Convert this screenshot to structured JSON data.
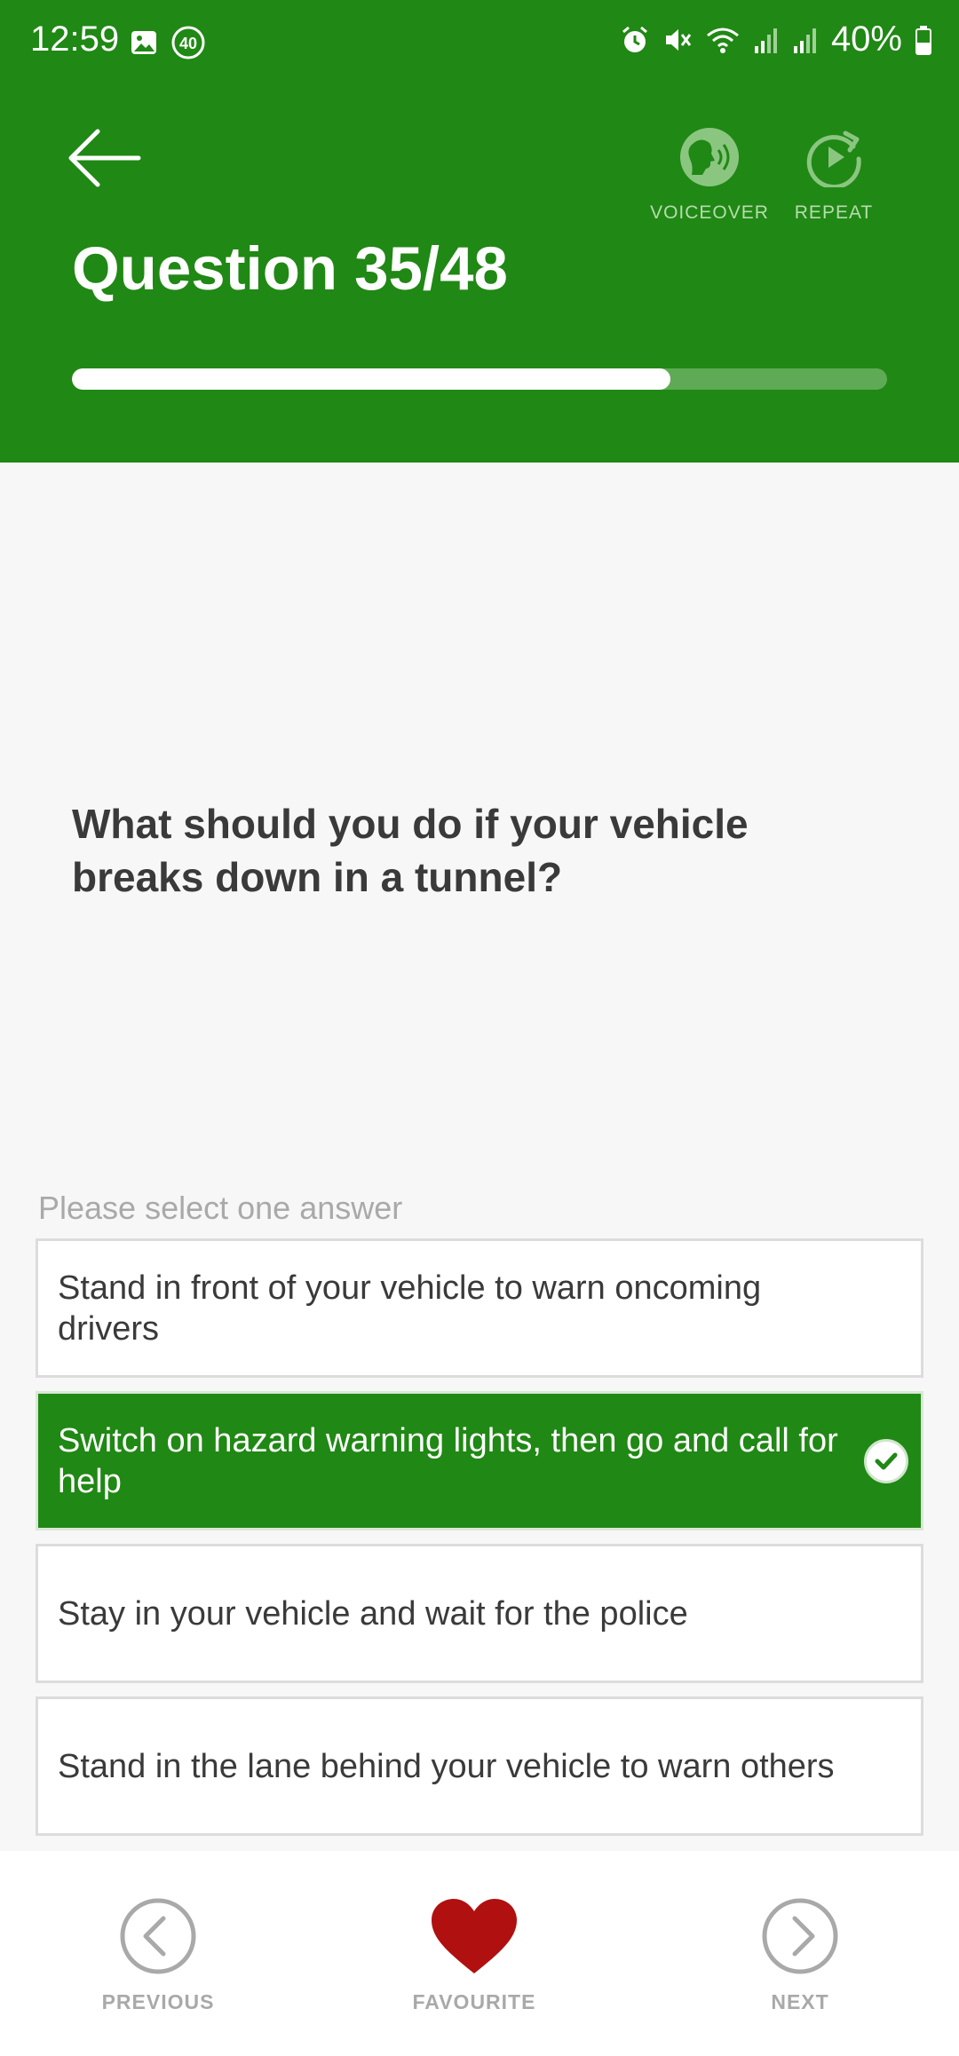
{
  "status_bar": {
    "time": "12:59",
    "notification_badge": "40",
    "battery": "40%",
    "icons": [
      "gallery-icon",
      "badge-40-icon",
      "alarm-icon",
      "mute-icon",
      "wifi-icon",
      "signal-icon",
      "signal-icon",
      "battery-icon"
    ]
  },
  "header": {
    "title": "Question 35/48",
    "voiceover_label": "VOICEOVER",
    "repeat_label": "REPEAT",
    "progress_fraction": 0.734
  },
  "question": {
    "text": "What should you do if your vehicle breaks down in a tunnel?",
    "hint": "Please select one answer"
  },
  "answers": [
    {
      "text": "Stand in front of your vehicle to warn oncoming drivers",
      "selected": false
    },
    {
      "text": "Switch on hazard warning lights, then go and call for help",
      "selected": true
    },
    {
      "text": "Stay in your vehicle and wait for the police",
      "selected": false
    },
    {
      "text": "Stand in the lane behind your vehicle to warn others",
      "selected": false
    }
  ],
  "footer": {
    "previous_label": "PREVIOUS",
    "favourite_label": "FAVOURITE",
    "next_label": "NEXT"
  },
  "colors": {
    "brand_green": "#208814",
    "favourite_red": "#b01010",
    "muted_grey": "#a9a9a9"
  }
}
